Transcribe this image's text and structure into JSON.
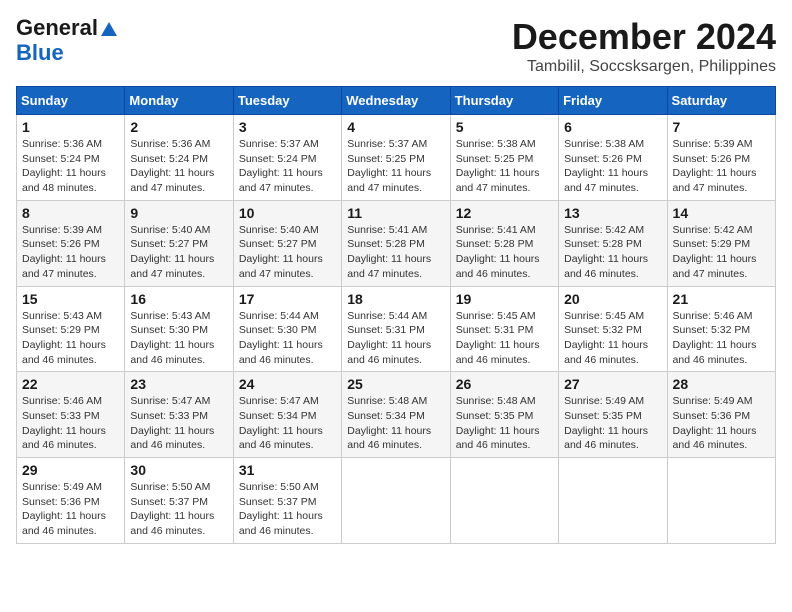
{
  "header": {
    "logo_line1": "General",
    "logo_line2": "Blue",
    "month": "December 2024",
    "location": "Tambilil, Soccsksargen, Philippines"
  },
  "weekdays": [
    "Sunday",
    "Monday",
    "Tuesday",
    "Wednesday",
    "Thursday",
    "Friday",
    "Saturday"
  ],
  "weeks": [
    [
      {
        "day": "1",
        "sunrise": "5:36 AM",
        "sunset": "5:24 PM",
        "daylight": "11 hours and 48 minutes."
      },
      {
        "day": "2",
        "sunrise": "5:36 AM",
        "sunset": "5:24 PM",
        "daylight": "11 hours and 47 minutes."
      },
      {
        "day": "3",
        "sunrise": "5:37 AM",
        "sunset": "5:24 PM",
        "daylight": "11 hours and 47 minutes."
      },
      {
        "day": "4",
        "sunrise": "5:37 AM",
        "sunset": "5:25 PM",
        "daylight": "11 hours and 47 minutes."
      },
      {
        "day": "5",
        "sunrise": "5:38 AM",
        "sunset": "5:25 PM",
        "daylight": "11 hours and 47 minutes."
      },
      {
        "day": "6",
        "sunrise": "5:38 AM",
        "sunset": "5:26 PM",
        "daylight": "11 hours and 47 minutes."
      },
      {
        "day": "7",
        "sunrise": "5:39 AM",
        "sunset": "5:26 PM",
        "daylight": "11 hours and 47 minutes."
      }
    ],
    [
      {
        "day": "8",
        "sunrise": "5:39 AM",
        "sunset": "5:26 PM",
        "daylight": "11 hours and 47 minutes."
      },
      {
        "day": "9",
        "sunrise": "5:40 AM",
        "sunset": "5:27 PM",
        "daylight": "11 hours and 47 minutes."
      },
      {
        "day": "10",
        "sunrise": "5:40 AM",
        "sunset": "5:27 PM",
        "daylight": "11 hours and 47 minutes."
      },
      {
        "day": "11",
        "sunrise": "5:41 AM",
        "sunset": "5:28 PM",
        "daylight": "11 hours and 47 minutes."
      },
      {
        "day": "12",
        "sunrise": "5:41 AM",
        "sunset": "5:28 PM",
        "daylight": "11 hours and 46 minutes."
      },
      {
        "day": "13",
        "sunrise": "5:42 AM",
        "sunset": "5:28 PM",
        "daylight": "11 hours and 46 minutes."
      },
      {
        "day": "14",
        "sunrise": "5:42 AM",
        "sunset": "5:29 PM",
        "daylight": "11 hours and 47 minutes."
      }
    ],
    [
      {
        "day": "15",
        "sunrise": "5:43 AM",
        "sunset": "5:29 PM",
        "daylight": "11 hours and 46 minutes."
      },
      {
        "day": "16",
        "sunrise": "5:43 AM",
        "sunset": "5:30 PM",
        "daylight": "11 hours and 46 minutes."
      },
      {
        "day": "17",
        "sunrise": "5:44 AM",
        "sunset": "5:30 PM",
        "daylight": "11 hours and 46 minutes."
      },
      {
        "day": "18",
        "sunrise": "5:44 AM",
        "sunset": "5:31 PM",
        "daylight": "11 hours and 46 minutes."
      },
      {
        "day": "19",
        "sunrise": "5:45 AM",
        "sunset": "5:31 PM",
        "daylight": "11 hours and 46 minutes."
      },
      {
        "day": "20",
        "sunrise": "5:45 AM",
        "sunset": "5:32 PM",
        "daylight": "11 hours and 46 minutes."
      },
      {
        "day": "21",
        "sunrise": "5:46 AM",
        "sunset": "5:32 PM",
        "daylight": "11 hours and 46 minutes."
      }
    ],
    [
      {
        "day": "22",
        "sunrise": "5:46 AM",
        "sunset": "5:33 PM",
        "daylight": "11 hours and 46 minutes."
      },
      {
        "day": "23",
        "sunrise": "5:47 AM",
        "sunset": "5:33 PM",
        "daylight": "11 hours and 46 minutes."
      },
      {
        "day": "24",
        "sunrise": "5:47 AM",
        "sunset": "5:34 PM",
        "daylight": "11 hours and 46 minutes."
      },
      {
        "day": "25",
        "sunrise": "5:48 AM",
        "sunset": "5:34 PM",
        "daylight": "11 hours and 46 minutes."
      },
      {
        "day": "26",
        "sunrise": "5:48 AM",
        "sunset": "5:35 PM",
        "daylight": "11 hours and 46 minutes."
      },
      {
        "day": "27",
        "sunrise": "5:49 AM",
        "sunset": "5:35 PM",
        "daylight": "11 hours and 46 minutes."
      },
      {
        "day": "28",
        "sunrise": "5:49 AM",
        "sunset": "5:36 PM",
        "daylight": "11 hours and 46 minutes."
      }
    ],
    [
      {
        "day": "29",
        "sunrise": "5:49 AM",
        "sunset": "5:36 PM",
        "daylight": "11 hours and 46 minutes."
      },
      {
        "day": "30",
        "sunrise": "5:50 AM",
        "sunset": "5:37 PM",
        "daylight": "11 hours and 46 minutes."
      },
      {
        "day": "31",
        "sunrise": "5:50 AM",
        "sunset": "5:37 PM",
        "daylight": "11 hours and 46 minutes."
      },
      null,
      null,
      null,
      null
    ]
  ],
  "labels": {
    "sunrise": "Sunrise:",
    "sunset": "Sunset:",
    "daylight": "Daylight:"
  }
}
